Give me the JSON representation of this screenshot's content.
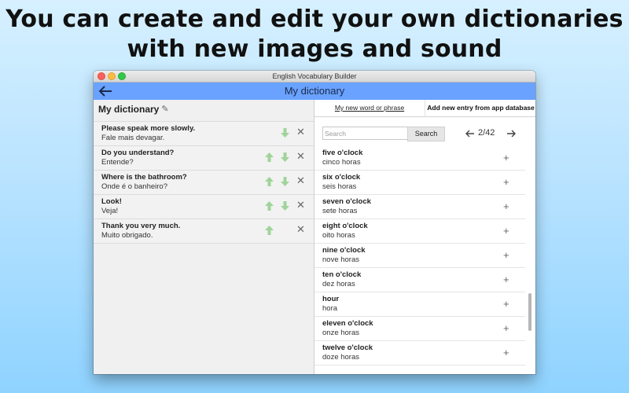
{
  "headline": {
    "line1": "You can create and edit your own dictionaries",
    "line2": "with new images and sound"
  },
  "window": {
    "title": "English Vocabulary Builder",
    "header_title": "My dictionary"
  },
  "left_pane": {
    "title": "My dictionary",
    "items": [
      {
        "en": "Please speak more slowly.",
        "pt": "Fale mais devagar.",
        "up": false,
        "down": true
      },
      {
        "en": "Do you understand?",
        "pt": "Entende?",
        "up": true,
        "down": true
      },
      {
        "en": "Where is the bathroom?",
        "pt": "Onde é o banheiro?",
        "up": true,
        "down": true
      },
      {
        "en": "Look!",
        "pt": "Veja!",
        "up": true,
        "down": true
      },
      {
        "en": "Thank you very much.",
        "pt": "Muito obrigado.",
        "up": true,
        "down": false
      }
    ],
    "delete_glyph": "✕"
  },
  "right_pane": {
    "tabs": [
      "My new word or phrase",
      "Add new entry from app database"
    ],
    "search": {
      "placeholder": "Search",
      "button_label": "Search"
    },
    "pager": {
      "text": "2/42"
    },
    "add_glyph": "+",
    "words": [
      {
        "en": "five o'clock",
        "pt": "cinco horas"
      },
      {
        "en": "six o'clock",
        "pt": "seis horas"
      },
      {
        "en": "seven o'clock",
        "pt": "sete horas"
      },
      {
        "en": "eight o'clock",
        "pt": "oito horas"
      },
      {
        "en": "nine o'clock",
        "pt": "nove horas"
      },
      {
        "en": "ten o'clock",
        "pt": "dez horas"
      },
      {
        "en": "hour",
        "pt": "hora"
      },
      {
        "en": "eleven o'clock",
        "pt": "onze horas"
      },
      {
        "en": "twelve o'clock",
        "pt": "doze horas"
      }
    ]
  },
  "colors": {
    "appbar": "#6aa2ff",
    "arrow_green": "#9fd49a",
    "background_top": "#d6f0ff",
    "background_bottom": "#8fd3ff"
  }
}
